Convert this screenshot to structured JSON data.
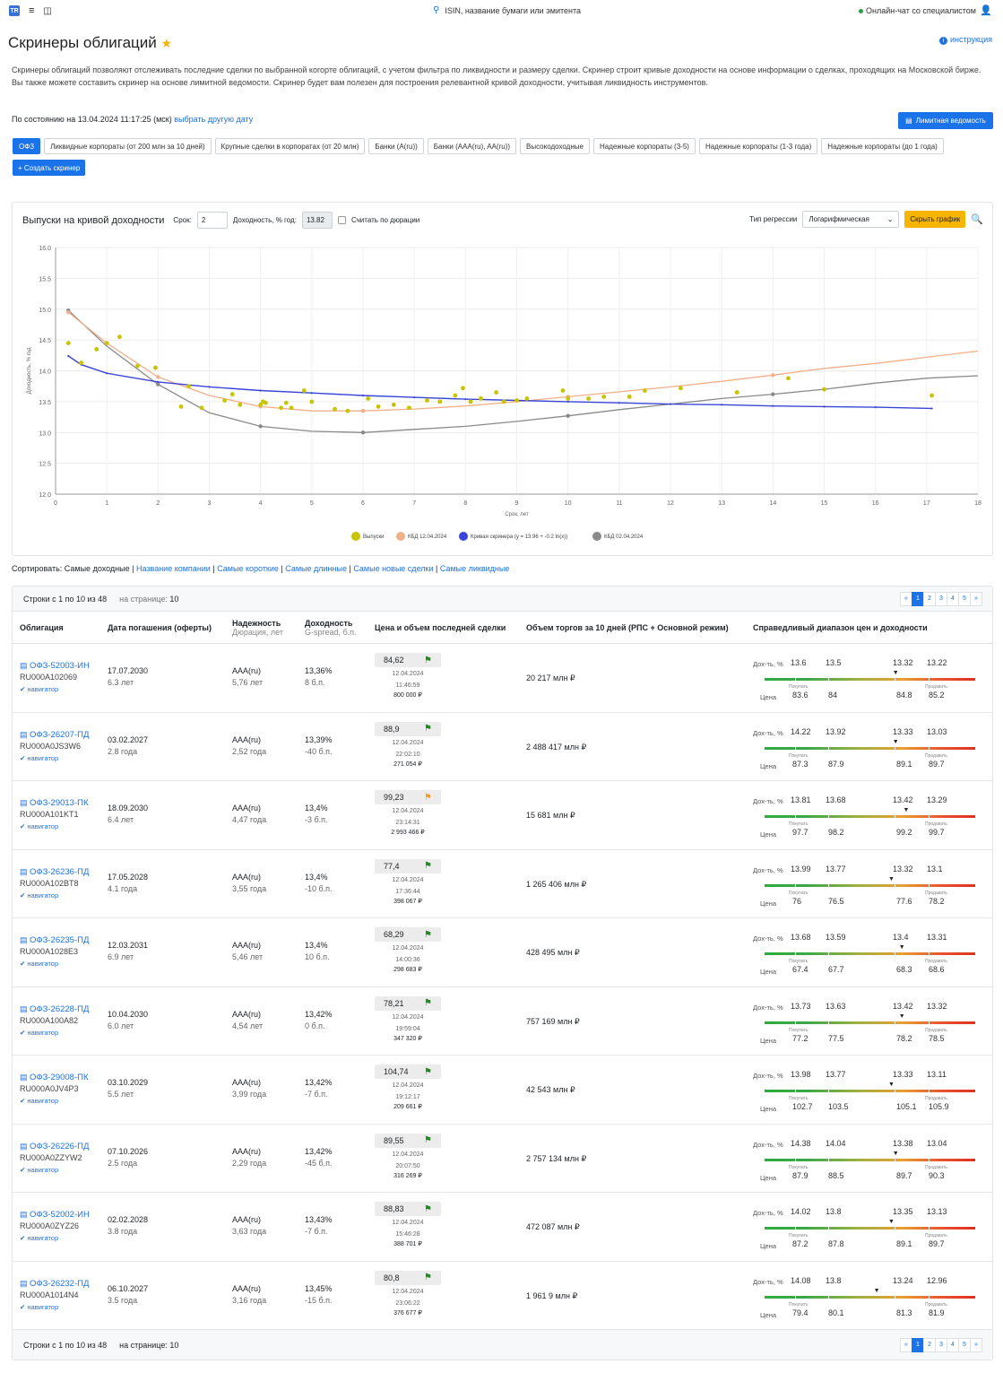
{
  "topbar": {
    "logo": "TR",
    "search_placeholder": "ISIN, название бумаги или эмитента",
    "chat": "Онлайн-чат со специалистом"
  },
  "page": {
    "title": "Скринеры облигаций",
    "instruction": "инструкция",
    "description": "Скринеры облигаций позволяют отслеживать последние сделки по выбранной когорте облигаций, с учетом фильтра по ликвидности и размеру сделки. Скринер строит кривые доходности на основе информации о сделках, проходящих на Московской бирже. Вы также можете составить скринер на основе лимитной ведомости. Скринер будет вам полезен для построения релевантной кривой доходности, учитывая ликвидность инструментов.",
    "state_prefix": "По состоянию на 13.04.2024 11:17:25 (мск)",
    "state_link": "выбрать другую дату",
    "limit_button": "Лимитная ведомость",
    "create_button": "+ Создать скринер"
  },
  "tabs": [
    "ОФЗ",
    "Ликвидные корпораты (от 200 млн за 10 дней)",
    "Крупные сделки в корпоратах (от 20 млн)",
    "Банки (A(ru))",
    "Банки (AAA(ru), AA(ru))",
    "Высокодоходные",
    "Надежные корпораты (3-5)",
    "Надежные корпораты (1-3 года)",
    "Надежные корпораты (до 1 года)"
  ],
  "chart_panel": {
    "title": "Выпуски на кривой доходности",
    "term_label": "Срок:",
    "term_value": "2",
    "yield_label": "Доходность, % год:",
    "yield_value": "13.82",
    "duration_label": "Считать по дюрации",
    "regression_label": "Тип регрессии",
    "regression_value": "Логарифмическая",
    "hide_button": "Скрыть график"
  },
  "chart_data": {
    "type": "scatter",
    "xlabel": "Срок, лет",
    "ylabel": "Доходность, % год",
    "xlim": [
      0,
      18
    ],
    "ylim": [
      12.0,
      16.0
    ],
    "x_ticks": [
      0,
      1,
      2,
      3,
      4,
      5,
      6,
      7,
      8,
      9,
      10,
      11,
      12,
      13,
      14,
      15,
      16,
      17,
      18
    ],
    "y_ticks": [
      "12.0",
      "12.5",
      "13.0",
      "13.5",
      "14.0",
      "14.5",
      "15.0",
      "15.5",
      "16.0"
    ],
    "legend": [
      "Выпуски",
      "КБД 12.04.2024",
      "Кривая скринера (y = 13.96 + -0.2 ln(x))",
      "КБД 02.04.2024"
    ],
    "colors": {
      "issues": "#c8c400",
      "kbd12": "#f0b08a",
      "screener": "#3a45d8",
      "kbd02": "#8a8a8a"
    },
    "issues": [
      [
        0.25,
        14.45
      ],
      [
        0.5,
        14.13
      ],
      [
        0.8,
        14.35
      ],
      [
        1.0,
        14.45
      ],
      [
        1.25,
        14.55
      ],
      [
        1.6,
        14.08
      ],
      [
        1.95,
        14.05
      ],
      [
        2.45,
        13.42
      ],
      [
        2.6,
        13.75
      ],
      [
        2.85,
        13.4
      ],
      [
        3.3,
        13.52
      ],
      [
        3.45,
        13.62
      ],
      [
        3.6,
        13.45
      ],
      [
        4.0,
        13.45
      ],
      [
        4.05,
        13.5
      ],
      [
        4.1,
        13.48
      ],
      [
        4.4,
        13.4
      ],
      [
        4.5,
        13.48
      ],
      [
        4.6,
        13.4
      ],
      [
        4.85,
        13.68
      ],
      [
        5.0,
        13.5
      ],
      [
        5.45,
        13.38
      ],
      [
        5.7,
        13.35
      ],
      [
        6.1,
        13.55
      ],
      [
        6.3,
        13.42
      ],
      [
        6.6,
        13.45
      ],
      [
        6.9,
        13.4
      ],
      [
        7.25,
        13.52
      ],
      [
        7.5,
        13.5
      ],
      [
        7.8,
        13.6
      ],
      [
        7.95,
        13.72
      ],
      [
        8.1,
        13.5
      ],
      [
        8.3,
        13.55
      ],
      [
        8.6,
        13.65
      ],
      [
        8.75,
        13.5
      ],
      [
        9.0,
        13.52
      ],
      [
        9.2,
        13.55
      ],
      [
        9.9,
        13.68
      ],
      [
        10.0,
        13.55
      ],
      [
        10.4,
        13.55
      ],
      [
        10.7,
        13.58
      ],
      [
        11.2,
        13.58
      ],
      [
        11.5,
        13.68
      ],
      [
        12.2,
        13.72
      ],
      [
        13.3,
        13.65
      ],
      [
        14.3,
        13.88
      ],
      [
        15.0,
        13.7
      ],
      [
        17.1,
        13.6
      ]
    ],
    "kbd12": [
      [
        0.25,
        14.95
      ],
      [
        1,
        14.45
      ],
      [
        2,
        13.9
      ],
      [
        3,
        13.6
      ],
      [
        4,
        13.42
      ],
      [
        5,
        13.35
      ],
      [
        6,
        13.35
      ],
      [
        7,
        13.38
      ],
      [
        8,
        13.43
      ],
      [
        9,
        13.5
      ],
      [
        10,
        13.58
      ],
      [
        11,
        13.66
      ],
      [
        12,
        13.74
      ],
      [
        13,
        13.83
      ],
      [
        14,
        13.93
      ],
      [
        15,
        14.04
      ],
      [
        16,
        14.12
      ],
      [
        17,
        14.22
      ],
      [
        18,
        14.32
      ]
    ],
    "kbd02": [
      [
        0.25,
        14.98
      ],
      [
        1,
        14.4
      ],
      [
        2,
        13.78
      ],
      [
        3,
        13.32
      ],
      [
        4,
        13.1
      ],
      [
        5,
        13.02
      ],
      [
        6,
        13.0
      ],
      [
        7,
        13.05
      ],
      [
        8,
        13.1
      ],
      [
        9,
        13.18
      ],
      [
        10,
        13.27
      ],
      [
        11,
        13.37
      ],
      [
        12,
        13.46
      ],
      [
        13,
        13.55
      ],
      [
        14,
        13.62
      ],
      [
        15,
        13.7
      ],
      [
        16,
        13.8
      ],
      [
        17,
        13.88
      ],
      [
        18,
        13.92
      ]
    ],
    "screener": [
      [
        0.25,
        14.24
      ],
      [
        0.5,
        14.1
      ],
      [
        1,
        13.96
      ],
      [
        2,
        13.82
      ],
      [
        3,
        13.74
      ],
      [
        4,
        13.68
      ],
      [
        5,
        13.64
      ],
      [
        6,
        13.6
      ],
      [
        7,
        13.57
      ],
      [
        8,
        13.54
      ],
      [
        9,
        13.52
      ],
      [
        10,
        13.5
      ],
      [
        11,
        13.48
      ],
      [
        12,
        13.46
      ],
      [
        13,
        13.45
      ],
      [
        14,
        13.43
      ],
      [
        15,
        13.42
      ],
      [
        16,
        13.41
      ],
      [
        17.1,
        13.39
      ]
    ]
  },
  "sort": {
    "label": "Сортировать:",
    "current": "Самые доходные",
    "options": [
      "Название компании",
      "Самые короткие",
      "Самые длинные",
      "Самые новые сделки",
      "Самые ликвидные"
    ]
  },
  "table": {
    "rows_info": "Строки с 1 по 10 из 48",
    "per_page_label": "на странице:",
    "per_page": "10",
    "pages": [
      "«",
      "1",
      "2",
      "3",
      "4",
      "5",
      "»"
    ],
    "headers": {
      "bond": "Облигация",
      "maturity": "Дата погашения (оферты)",
      "rating": "Надежность",
      "rating_sub": "Дюрация, лет",
      "yield": "Доходность",
      "yield_sub": "G-spread, б.п.",
      "last": "Цена и объем последней сделки",
      "volume": "Объем торгов за 10 дней (РПС + Основной режим)",
      "fair": "Справедливый диапазон цен и доходности"
    },
    "fair_labels": {
      "yield": "Дох-ть, %",
      "price": "Цена",
      "buy": "Покупать",
      "sell": "Продавать"
    },
    "nav_label": "навигатор",
    "rows": [
      {
        "name": "ОФЗ-52003-ИН",
        "isin": "RU000A102069",
        "date": "17.07.2030",
        "years": "6.3 лет",
        "rating": "AAA(ru)",
        "dur": "5,76 лет",
        "yield": "13,36%",
        "spread": "8 б.п.",
        "price": "84,62",
        "flag": "green",
        "tdate": "12.04.2024",
        "ttime": "11:46:59",
        "tvol": "800 000 ₽",
        "volume": "20 217 млн ₽",
        "y": [
          "13.6",
          "13.5",
          "13.32",
          "13.22"
        ],
        "p": [
          "83.6",
          "84",
          "84.8",
          "85.2"
        ],
        "marker": 0.62
      },
      {
        "name": "ОФЗ-26207-ПД",
        "isin": "RU000A0JS3W6",
        "date": "03.02.2027",
        "years": "2.8 года",
        "rating": "AAA(ru)",
        "dur": "2,52 года",
        "yield": "13,39%",
        "spread": "-40 б.п.",
        "price": "88,9",
        "flag": "green",
        "tdate": "12.04.2024",
        "ttime": "22:02:10",
        "tvol": "271 054 ₽",
        "volume": "2 488 417 млн ₽",
        "y": [
          "14.22",
          "13.92",
          "13.33",
          "13.03"
        ],
        "p": [
          "87.3",
          "87.9",
          "89.1",
          "89.7"
        ],
        "marker": 0.62
      },
      {
        "name": "ОФЗ-29013-ПК",
        "isin": "RU000A101KT1",
        "date": "18.09.2030",
        "years": "6.4 лет",
        "rating": "AAA(ru)",
        "dur": "4,47 года",
        "yield": "13,4%",
        "spread": "-3 б.п.",
        "price": "99,23",
        "flag": "orange",
        "tdate": "12.04.2024",
        "ttime": "23:14:31",
        "tvol": "2 993 466 ₽",
        "volume": "15 681 млн ₽",
        "y": [
          "13.81",
          "13.68",
          "13.42",
          "13.29"
        ],
        "p": [
          "97.7",
          "98.2",
          "99.2",
          "99.7"
        ],
        "marker": 0.67
      },
      {
        "name": "ОФЗ-26236-ПД",
        "isin": "RU000A102BT8",
        "date": "17.05.2028",
        "years": "4.1 года",
        "rating": "AAA(ru)",
        "dur": "3,55 года",
        "yield": "13,4%",
        "spread": "-10 б.п.",
        "price": "77,4",
        "flag": "green",
        "tdate": "12.04.2024",
        "ttime": "17:36:44",
        "tvol": "398 067 ₽",
        "volume": "1 265 406 млн ₽",
        "y": [
          "13.99",
          "13.77",
          "13.32",
          "13.1"
        ],
        "p": [
          "76",
          "76.5",
          "77.6",
          "78.2"
        ],
        "marker": 0.6
      },
      {
        "name": "ОФЗ-26235-ПД",
        "isin": "RU000A1028E3",
        "date": "12.03.2031",
        "years": "6.9 лет",
        "rating": "AAA(ru)",
        "dur": "5,46 лет",
        "yield": "13,4%",
        "spread": "10 б.п.",
        "price": "68,29",
        "flag": "green",
        "tdate": "12.04.2024",
        "ttime": "14:00:36",
        "tvol": "298 683 ₽",
        "volume": "428 495 млн ₽",
        "y": [
          "13.68",
          "13.59",
          "13.4",
          "13.31"
        ],
        "p": [
          "67.4",
          "67.7",
          "68.3",
          "68.6"
        ],
        "marker": 0.65
      },
      {
        "name": "ОФЗ-26228-ПД",
        "isin": "RU000A100A82",
        "date": "10.04.2030",
        "years": "6.0 лет",
        "rating": "AAA(ru)",
        "dur": "4,54 лет",
        "yield": "13,42%",
        "spread": "0 б.п.",
        "price": "78,21",
        "flag": "green",
        "tdate": "12.04.2024",
        "ttime": "19:59:04",
        "tvol": "347 320 ₽",
        "volume": "757 169 млн ₽",
        "y": [
          "13.73",
          "13.63",
          "13.42",
          "13.32"
        ],
        "p": [
          "77.2",
          "77.5",
          "78.2",
          "78.5"
        ],
        "marker": 0.65
      },
      {
        "name": "ОФЗ-29008-ПК",
        "isin": "RU000A0JV4P3",
        "date": "03.10.2029",
        "years": "5.5 лет",
        "rating": "AAA(ru)",
        "dur": "3,99 года",
        "yield": "13,42%",
        "spread": "-7 б.п.",
        "price": "104,74",
        "flag": "green",
        "tdate": "12.04.2024",
        "ttime": "19:12:17",
        "tvol": "209 661 ₽",
        "volume": "42 543 млн ₽",
        "y": [
          "13.98",
          "13.77",
          "13.33",
          "13.11"
        ],
        "p": [
          "102.7",
          "103.5",
          "105.1",
          "105.9"
        ],
        "marker": 0.6
      },
      {
        "name": "ОФЗ-26226-ПД",
        "isin": "RU000A0ZZYW2",
        "date": "07.10.2026",
        "years": "2.5 года",
        "rating": "AAA(ru)",
        "dur": "2,29 года",
        "yield": "13,42%",
        "spread": "-45 б.п.",
        "price": "89,55",
        "flag": "green",
        "tdate": "12.04.2024",
        "ttime": "20:07:50",
        "tvol": "316 269 ₽",
        "volume": "2 757 134 млн ₽",
        "y": [
          "14.38",
          "14.04",
          "13.38",
          "13.04"
        ],
        "p": [
          "87.9",
          "88.5",
          "89.7",
          "90.3"
        ],
        "marker": 0.62
      },
      {
        "name": "ОФЗ-52002-ИН",
        "isin": "RU000A0ZYZ26",
        "date": "02.02.2028",
        "years": "3.8 года",
        "rating": "AAA(ru)",
        "dur": "3,63 года",
        "yield": "13,43%",
        "spread": "-7 б.п.",
        "price": "88,83",
        "flag": "green",
        "tdate": "12.04.2024",
        "ttime": "15:46:28",
        "tvol": "388 701 ₽",
        "volume": "472 087 млн ₽",
        "y": [
          "14.02",
          "13.8",
          "13.35",
          "13.13"
        ],
        "p": [
          "87.2",
          "87.8",
          "89.1",
          "89.7"
        ],
        "marker": 0.6
      },
      {
        "name": "ОФЗ-26232-ПД",
        "isin": "RU000A1014N4",
        "date": "06.10.2027",
        "years": "3.5 года",
        "rating": "AAA(ru)",
        "dur": "3,16 года",
        "yield": "13,45%",
        "spread": "-15 б.п.",
        "price": "80,8",
        "flag": "green",
        "tdate": "12.04.2024",
        "ttime": "23:06:22",
        "tvol": "376 677 ₽",
        "volume": "1 961 9 млн ₽",
        "y": [
          "14.08",
          "13.8",
          "13.24",
          "12.96"
        ],
        "p": [
          "79.4",
          "80.1",
          "81.3",
          "81.9"
        ],
        "marker": 0.53
      }
    ]
  }
}
